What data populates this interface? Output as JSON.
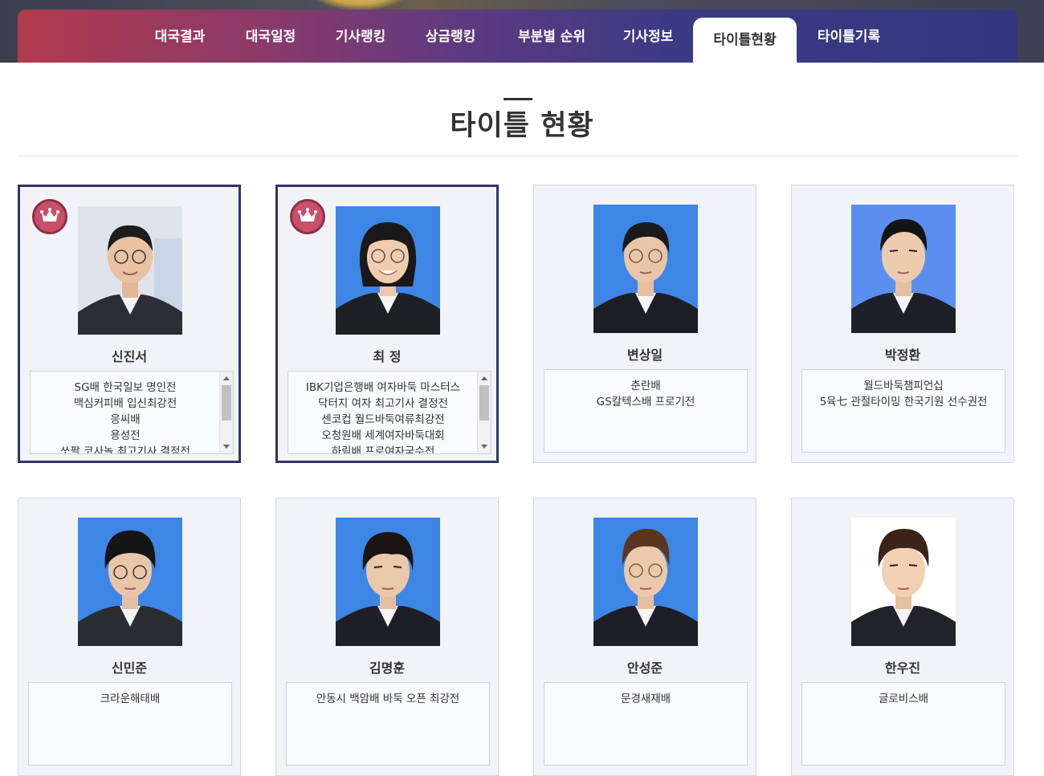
{
  "nav": {
    "items": [
      {
        "label": "대국결과"
      },
      {
        "label": "대국일정"
      },
      {
        "label": "기사랭킹"
      },
      {
        "label": "상금랭킹"
      },
      {
        "label": "부분별 순위"
      },
      {
        "label": "기사정보"
      },
      {
        "label": "타이틀현황",
        "active": true
      },
      {
        "label": "타이틀기록"
      }
    ]
  },
  "page": {
    "title": "타이틀 현황"
  },
  "players": [
    {
      "name": "신진서",
      "titles": [
        "SG배 한국일보 명인전",
        "맥심커피배 입신최강전",
        "응씨배",
        "용성전",
        "쏘팔 코사놀 최고기사 결정전"
      ],
      "crown": true
    },
    {
      "name": "최 정",
      "titles": [
        "IBK기업은행배 여자바둑 마스터스",
        "닥터지 여자 최고기사 결정전",
        "센코컵 월드바둑여류최강전",
        "오청원배 세계여자바둑대회",
        "하림배 프로여자국수전"
      ],
      "crown": true
    },
    {
      "name": "변상일",
      "titles": [
        "춘란배",
        "GS칼텍스배 프로기전"
      ]
    },
    {
      "name": "박정환",
      "titles": [
        "월드바둑챔피언십",
        "5육七 관절타이밍 한국기원 선수권전"
      ]
    },
    {
      "name": "신민준",
      "titles": [
        "크라운해태배"
      ]
    },
    {
      "name": "김명훈",
      "titles": [
        "안동시 백암배 바둑 오픈 최강전"
      ]
    },
    {
      "name": "안성준",
      "titles": [
        "문경새재배"
      ]
    },
    {
      "name": "한우진",
      "titles": [
        "글로비스배"
      ]
    }
  ],
  "colors": {
    "nav_start": "#b23a4d",
    "nav_end": "#33377e",
    "holder_border": "#2f3566",
    "crown_badge": "#c8506a",
    "photo_bg_blue": "#4a86e0"
  },
  "icons": {
    "crown": "crown-icon",
    "scroll_up": "scroll-up-arrow",
    "scroll_down": "scroll-down-arrow"
  }
}
